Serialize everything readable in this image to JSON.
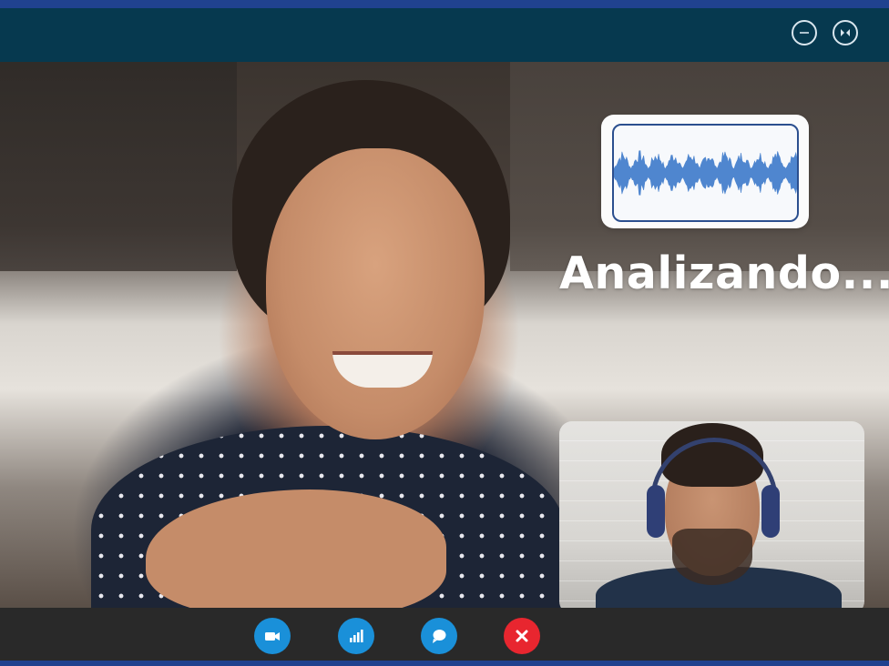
{
  "colors": {
    "titlebar": "#06394f",
    "accent_bar": "#20428f",
    "control_bar": "#292929",
    "control_button": "#1a90d9",
    "end_call_button": "#e8262f",
    "waveform": "#4f86cf",
    "waveform_frame": "#2b4f8f"
  },
  "window_controls": {
    "minimize_icon": "minus-circle-icon",
    "fit_icon": "collapse-arrows-icon"
  },
  "analysis": {
    "status_text": "Analizando...",
    "waveform_icon": "audio-waveform"
  },
  "controls": [
    {
      "name": "video-camera-button",
      "icon": "video-camera-icon",
      "color": "#1a90d9"
    },
    {
      "name": "signal-button",
      "icon": "signal-bars-icon",
      "color": "#1a90d9"
    },
    {
      "name": "chat-button",
      "icon": "chat-bubble-icon",
      "color": "#1a90d9"
    },
    {
      "name": "end-call-button",
      "icon": "close-x-icon",
      "color": "#e8262f"
    }
  ]
}
